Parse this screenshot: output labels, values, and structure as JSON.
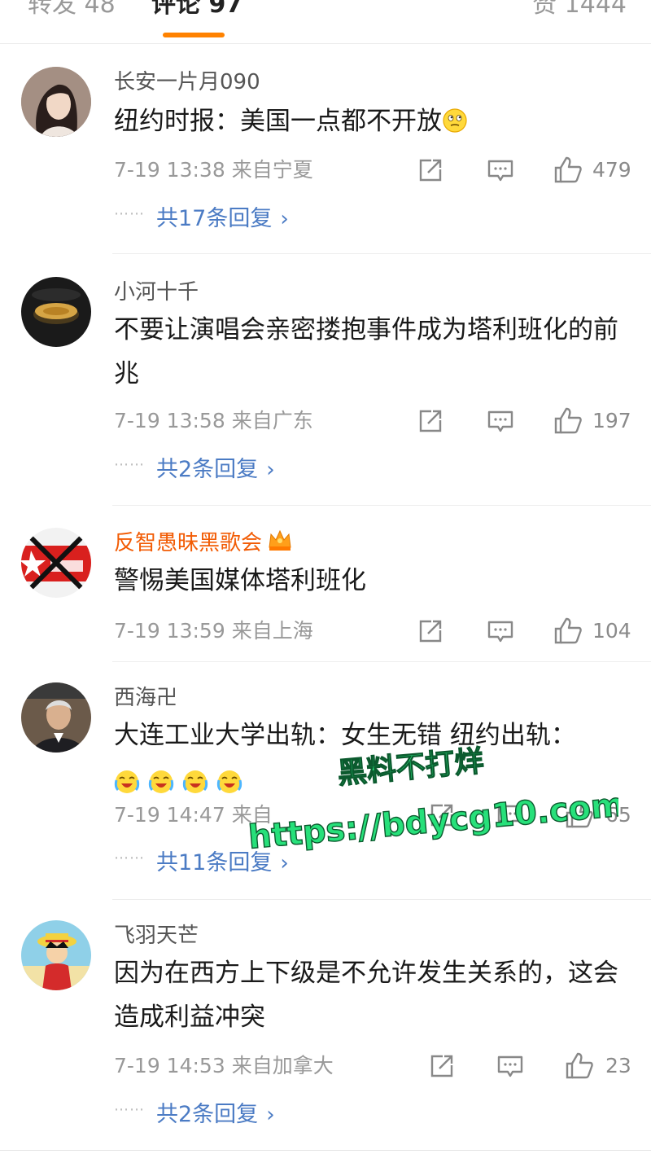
{
  "tabs": {
    "reposts": "转发 48",
    "comments": "评论 97",
    "likes": "赞 1444"
  },
  "comments": [
    {
      "username": "长安一片月090",
      "text": "纽约时报：美国一点都不开放",
      "time": "7-19 13:38",
      "location": "来自宁夏",
      "likes": "479",
      "replies": "共17条回复"
    },
    {
      "username": "小河十千",
      "text": "不要让演唱会亲密搂抱事件成为塔利班化的前兆",
      "time": "7-19 13:58",
      "location": "来自广东",
      "likes": "197",
      "replies": "共2条回复"
    },
    {
      "username": "反智愚昧黑歌会",
      "text": "警惕美国媒体塔利班化",
      "time": "7-19 13:59",
      "location": "来自上海",
      "likes": "104"
    },
    {
      "username": "西海卍",
      "text": "大连工业大学出轨：女生无错 纽约出轨：",
      "time": "7-19 14:47",
      "location": "来自",
      "likes": "65",
      "replies": "共11条回复"
    },
    {
      "username": "飞羽天芒",
      "text": "因为在西方上下级是不允许发生关系的，这会造成利益冲突",
      "time": "7-19 14:53",
      "location": "来自加拿大",
      "likes": "23",
      "replies": "共2条回复"
    }
  ],
  "icons": {
    "share": "share-icon",
    "comment": "comment-icon",
    "like": "thumbs-up-icon",
    "chevron": "chevron-right-icon"
  },
  "colors": {
    "accent": "#ff8200",
    "reply_link": "#4b7bc4",
    "vip_name": "#f25c05",
    "watermark": "#27e07a"
  },
  "watermark": {
    "line1": "黑料不打烊",
    "line2": "https://bdycg10.com"
  },
  "misc": {
    "dots": "⋯⋯",
    "chevron": "›"
  }
}
